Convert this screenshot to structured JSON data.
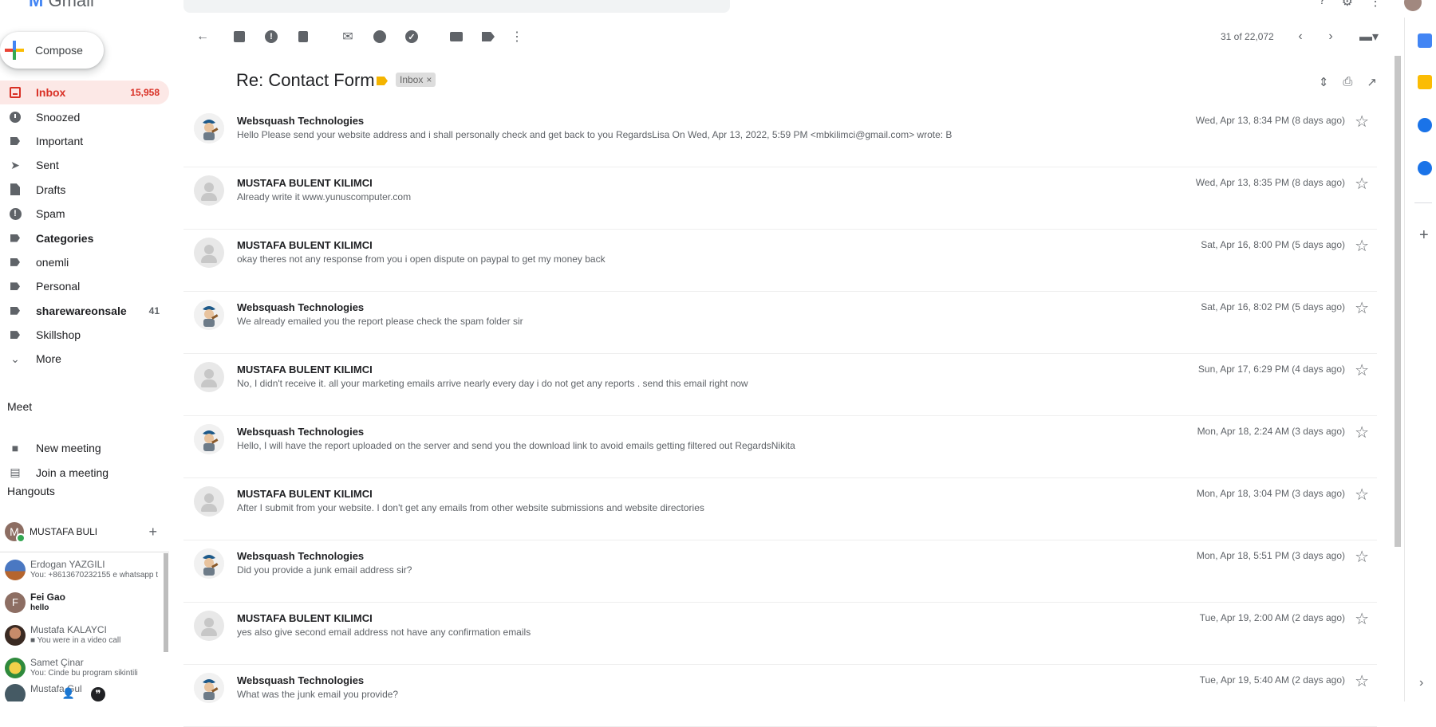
{
  "app": {
    "logo_text": "Gmail"
  },
  "compose": {
    "label": "Compose"
  },
  "nav": {
    "items": [
      {
        "label": "Inbox",
        "count": "15,958",
        "icon": "inbox-icon",
        "active": true
      },
      {
        "label": "Snoozed",
        "count": "",
        "icon": "clock-icon"
      },
      {
        "label": "Important",
        "count": "",
        "icon": "label-icon"
      },
      {
        "label": "Sent",
        "count": "",
        "icon": "send-icon"
      },
      {
        "label": "Drafts",
        "count": "",
        "icon": "draft-icon"
      },
      {
        "label": "Spam",
        "count": "",
        "icon": "spam-icon"
      },
      {
        "label": "Categories",
        "count": "",
        "icon": "label-icon",
        "bold": true
      },
      {
        "label": "onemli",
        "count": "",
        "icon": "label-icon"
      },
      {
        "label": "Personal",
        "count": "",
        "icon": "label-icon"
      },
      {
        "label": "sharewareonsale",
        "count": "41",
        "icon": "label-icon",
        "bold": true
      },
      {
        "label": "Skillshop",
        "count": "",
        "icon": "label-icon"
      },
      {
        "label": "More",
        "count": "",
        "icon": "chevron-down-icon"
      }
    ]
  },
  "meet": {
    "title": "Meet",
    "items": [
      {
        "label": "New meeting",
        "icon": "video-icon"
      },
      {
        "label": "Join a meeting",
        "icon": "keyboard-icon"
      }
    ]
  },
  "hangouts": {
    "title": "Hangouts",
    "current_user": "MUSTAFA BULI",
    "chats": [
      {
        "name": "Erdogan YAZGILI",
        "snippet": "You: +8613670232155 e whatsapp t",
        "bold": false
      },
      {
        "name": "Fei Gao",
        "snippet": "hello",
        "bold": true
      },
      {
        "name": "Mustafa KALAYCI",
        "snippet": "You were in a video call",
        "bold": false
      },
      {
        "name": "Samet Çinar",
        "snippet": "You: Cinde bu program sikintili",
        "bold": false
      },
      {
        "name": "Mustafa Gul",
        "snippet": "",
        "bold": false
      }
    ]
  },
  "toolbar": {
    "page_count": "31 of 22,072"
  },
  "thread": {
    "subject": "Re: Contact Form",
    "label": "Inbox",
    "messages": [
      {
        "sender": "Websquash Technologies",
        "snippet": "Hello Please send your website address and i shall personally check and get back to you RegardsLisa On Wed, Apr 13, 2022, 5:59 PM <mbkilimci@gmail.com> wrote: B",
        "date": "Wed, Apr 13, 8:34 PM (8 days ago)",
        "avatar": "websquash"
      },
      {
        "sender": "MUSTAFA BULENT KILIMCI",
        "snippet": "Already write it www.yunuscomputer.com",
        "date": "Wed, Apr 13, 8:35 PM (8 days ago)",
        "avatar": "default"
      },
      {
        "sender": "MUSTAFA BULENT KILIMCI",
        "snippet": "okay theres not any response from you i open dispute on paypal to get my money back",
        "date": "Sat, Apr 16, 8:00 PM (5 days ago)",
        "avatar": "default"
      },
      {
        "sender": "Websquash Technologies",
        "snippet": "We already emailed you the report please check the spam folder sir",
        "date": "Sat, Apr 16, 8:02 PM (5 days ago)",
        "avatar": "websquash"
      },
      {
        "sender": "MUSTAFA BULENT KILIMCI",
        "snippet": "No, I didn't receive it. all your marketing emails arrive nearly every day i do not get any reports . send this email right now",
        "date": "Sun, Apr 17, 6:29 PM (4 days ago)",
        "avatar": "default"
      },
      {
        "sender": "Websquash Technologies",
        "snippet": "Hello, I will have the report uploaded on the server and send you the download link to avoid emails getting filtered out RegardsNikita",
        "date": "Mon, Apr 18, 2:24 AM (3 days ago)",
        "avatar": "websquash"
      },
      {
        "sender": "MUSTAFA BULENT KILIMCI",
        "snippet": "After I submit from your website. I don't get any emails from other website submissions and website directories",
        "date": "Mon, Apr 18, 3:04 PM (3 days ago)",
        "avatar": "default"
      },
      {
        "sender": "Websquash Technologies",
        "snippet": "Did you provide a junk email address sir?",
        "date": "Mon, Apr 18, 5:51 PM (3 days ago)",
        "avatar": "websquash"
      },
      {
        "sender": "MUSTAFA BULENT KILIMCI",
        "snippet": "yes also give second email address not have any confirmation emails",
        "date": "Tue, Apr 19, 2:00 AM (2 days ago)",
        "avatar": "default"
      },
      {
        "sender": "Websquash Technologies",
        "snippet": "What was the junk email you provide?",
        "date": "Tue, Apr 19, 5:40 AM (2 days ago)",
        "avatar": "websquash"
      }
    ]
  },
  "colors": {
    "inbox_active_bg": "#fce8e6",
    "inbox_active_text": "#d93025",
    "importance_marker": "#f4b400"
  }
}
